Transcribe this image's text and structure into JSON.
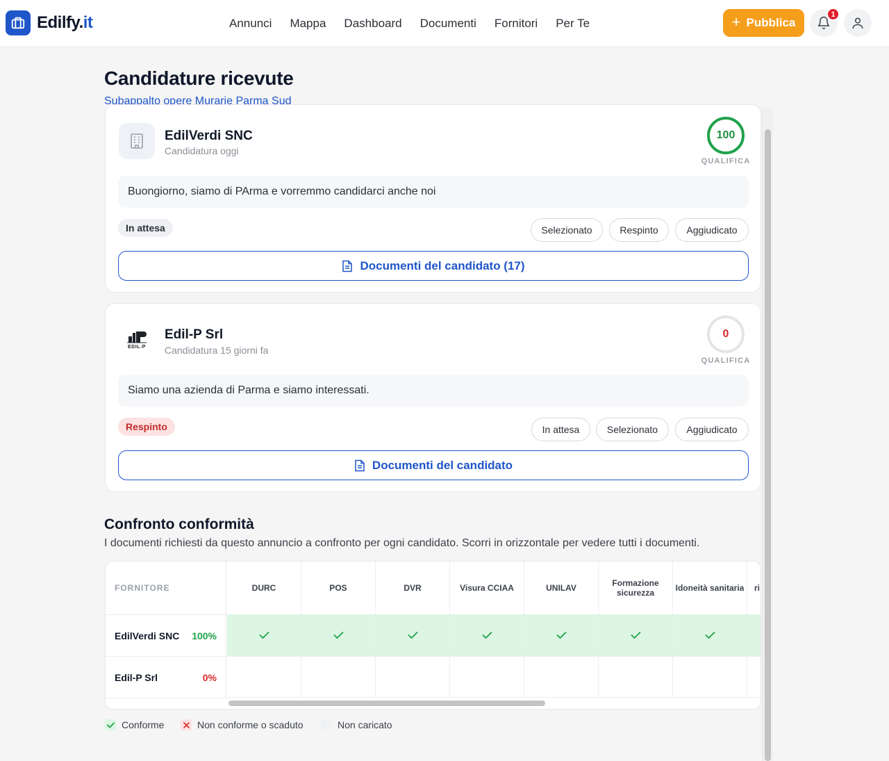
{
  "header": {
    "brand_main": "Edilfy.",
    "brand_accent": "it",
    "nav": [
      "Annunci",
      "Mappa",
      "Dashboard",
      "Documenti",
      "Fornitori",
      "Per Te"
    ],
    "publish_label": "Pubblica",
    "notifications_count": "1",
    "icons": {
      "logo": "briefcase-icon",
      "bell": "bell-icon",
      "user": "user-icon",
      "plus": "plus-icon"
    }
  },
  "page": {
    "title": "Candidature ricevute",
    "subtitle": "Subappalto opere Murarie Parma Sud"
  },
  "candidates": [
    {
      "name": "EdilVerdi SNC",
      "time": "Candidatura oggi",
      "score": "100",
      "score_label": "QUALIFICA",
      "message": "Buongiorno, siamo di PArma e vorremmo candidarci anche noi",
      "status": "In attesa",
      "actions": [
        "Selezionato",
        "Respinto",
        "Aggiudicato"
      ],
      "docs_label": "Documenti del candidato (17)"
    },
    {
      "name": "Edil-P Srl",
      "time": "Candidatura 15 giorni fa",
      "score": "0",
      "score_label": "QUALIFICA",
      "message": "Siamo una azienda di Parma e siamo interessati.",
      "status": "Respinto",
      "actions": [
        "In attesa",
        "Selezionato",
        "Aggiudicato"
      ],
      "docs_label": "Documenti del candidato",
      "logo_text": "EDIL-P"
    }
  ],
  "compliance": {
    "title": "Confronto conformità",
    "description": "I documenti richiesti da questo annuncio a confronto per ogni candidato. Scorri in orizzontale per vedere tutti i documenti.",
    "supplier_header": "FORNITORE",
    "columns": [
      "DURC",
      "POS",
      "DVR",
      "Visura CCIAA",
      "UNILAV",
      "Formazione sicurezza",
      "Idoneità sanitaria",
      "ri"
    ],
    "rows": [
      {
        "name": "EdilVerdi SNC",
        "pct": "100%",
        "status": "conforme"
      },
      {
        "name": "Edil-P Srl",
        "pct": "0%",
        "status": "non-caricato"
      }
    ],
    "legend": [
      "Conforme",
      "Non conforme o scaduto",
      "Non caricato"
    ]
  },
  "colors": {
    "primary": "#1f56c9",
    "accent": "#f59e1b",
    "success": "#1fa24a",
    "danger": "#d92b2b"
  }
}
